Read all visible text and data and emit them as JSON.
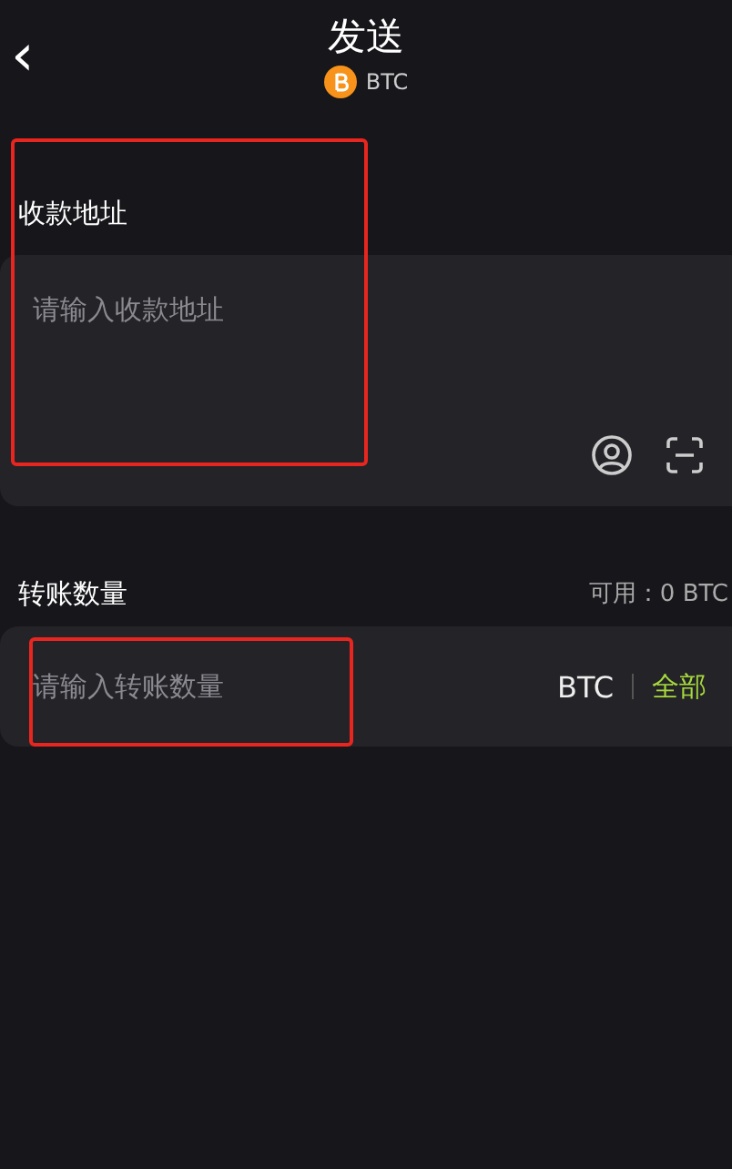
{
  "header": {
    "back_icon": "‹",
    "title": "发送",
    "coin": "BTC"
  },
  "address": {
    "label": "收款地址",
    "placeholder": "请输入收款地址",
    "highlighted": true
  },
  "amount": {
    "label": "转账数量",
    "available": "可用：0 BTC",
    "placeholder": "请输入转账数量",
    "unit": "BTC",
    "all_button": "全部",
    "highlighted": true
  }
}
